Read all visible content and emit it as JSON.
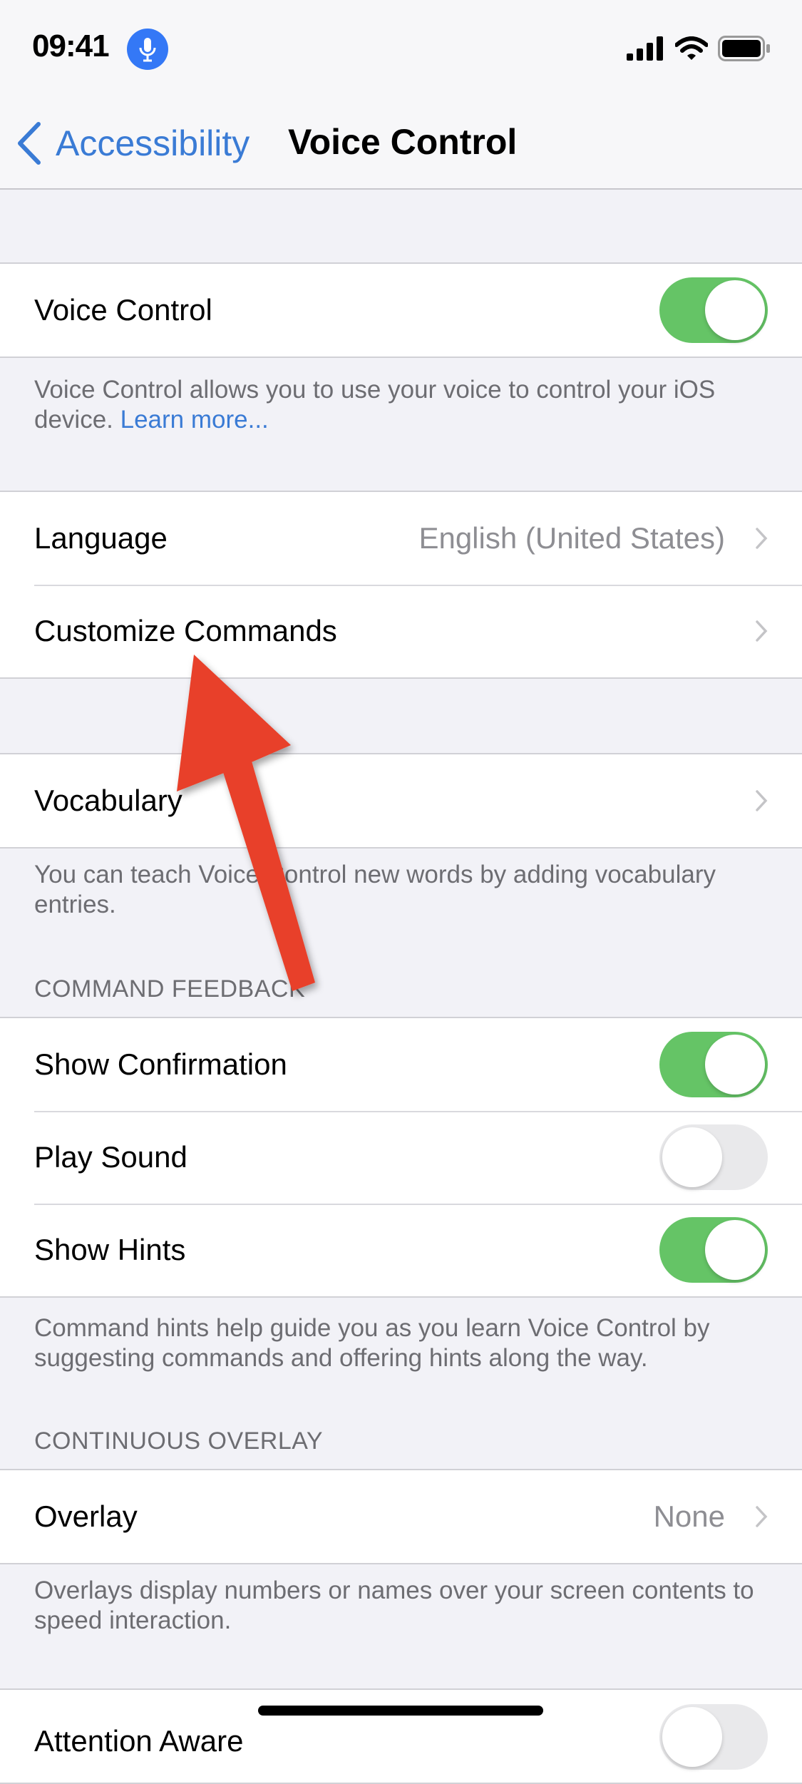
{
  "status_bar": {
    "time": "09:41",
    "mic_active": true,
    "signal": "signal-icon",
    "wifi": "wifi-icon",
    "battery": "battery-icon"
  },
  "nav": {
    "back_label": "Accessibility",
    "title": "Voice Control"
  },
  "sections": {
    "voice_control": {
      "label": "Voice Control",
      "toggle_on": true,
      "footer_text": "Voice Control allows you to use your voice to control your iOS device. ",
      "footer_link": "Learn more..."
    },
    "language": {
      "label": "Language",
      "value": "English (United States)"
    },
    "customize": {
      "label": "Customize Commands"
    },
    "vocabulary": {
      "label": "Vocabulary",
      "footer_text": "You can teach Voice Control new words by adding vocabulary entries."
    },
    "command_feedback": {
      "header": "COMMAND FEEDBACK",
      "items": [
        {
          "label": "Show Confirmation",
          "toggle_on": true
        },
        {
          "label": "Play Sound",
          "toggle_on": false
        },
        {
          "label": "Show Hints",
          "toggle_on": true
        }
      ],
      "footer_text": "Command hints help guide you as you learn Voice Control by suggesting commands and offering hints along the way."
    },
    "continuous_overlay": {
      "header": "CONTINUOUS OVERLAY",
      "label": "Overlay",
      "value": "None",
      "footer_text": "Overlays display numbers or names over your screen contents to speed interaction."
    },
    "attention": {
      "label": "Attention Aware",
      "toggle_on": false
    }
  },
  "annotation": {
    "type": "arrow",
    "color": "#e8412a",
    "points_to": "Customize Commands"
  }
}
